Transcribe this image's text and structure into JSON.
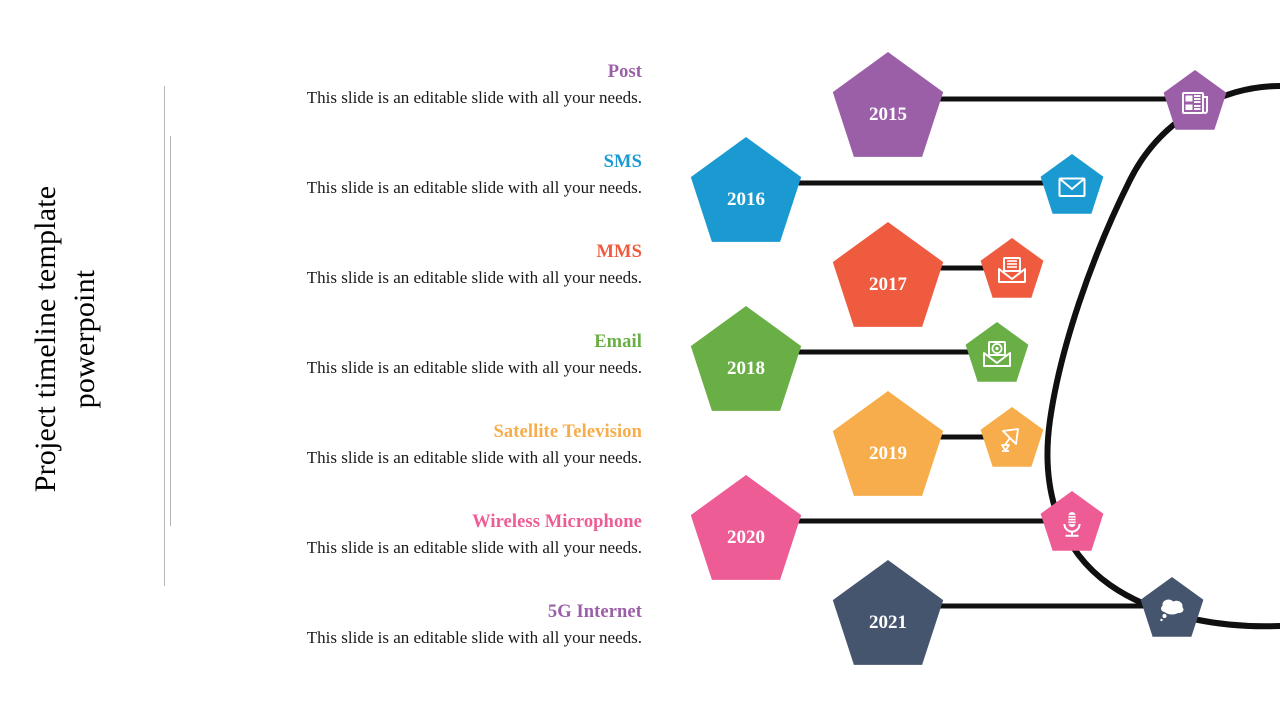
{
  "slide": {
    "title": "Project timeline template\npowerpoint",
    "background": "#ffffff"
  },
  "entries": [
    {
      "heading": "Post",
      "body": "This slide is an editable slide with all your needs.",
      "color": "#9B5FA8",
      "year": "2015",
      "icon": "newspaper-icon"
    },
    {
      "heading": "SMS",
      "body": "This slide is an editable slide with all your needs.",
      "color": "#1B9AD1",
      "year": "2016",
      "icon": "envelope-closed-icon"
    },
    {
      "heading": "MMS",
      "body": "This slide is an editable slide with all your needs.",
      "color": "#EF5B3F",
      "year": "2017",
      "icon": "envelope-open-document-icon"
    },
    {
      "heading": "Email",
      "body": "This slide is an editable slide with all your needs.",
      "color": "#6AAF46",
      "year": "2018",
      "icon": "envelope-open-at-icon"
    },
    {
      "heading": "Satellite Television",
      "body": "This slide is an editable slide with all your needs.",
      "color": "#F7AD4B",
      "year": "2019",
      "icon": "satellite-dish-icon"
    },
    {
      "heading": "Wireless Microphone",
      "body": "This slide is an editable slide with all your needs.",
      "color": "#EE5C96",
      "year": "2020",
      "icon": "microphone-icon"
    },
    {
      "heading": "5G Internet",
      "body": "This slide is an editable slide with all your needs.",
      "color": "#46556E",
      "year": "2021",
      "icon": "cloud-icon"
    }
  ],
  "chart_data": {
    "type": "diagram",
    "title": "Project timeline template powerpoint",
    "years": [
      "2015",
      "2016",
      "2017",
      "2018",
      "2019",
      "2020",
      "2021"
    ],
    "labels": [
      "Post",
      "SMS",
      "MMS",
      "Email",
      "Satellite Television",
      "Wireless Microphone",
      "5G Internet"
    ],
    "colors": [
      "#9B5FA8",
      "#1B9AD1",
      "#EF5B3F",
      "#6AAF46",
      "#F7AD4B",
      "#EE5C96",
      "#46556E"
    ],
    "connector_color": "#101010",
    "note": "Seven pentagon milestones connected by horizontal rules to icon pentagons along an arc"
  }
}
